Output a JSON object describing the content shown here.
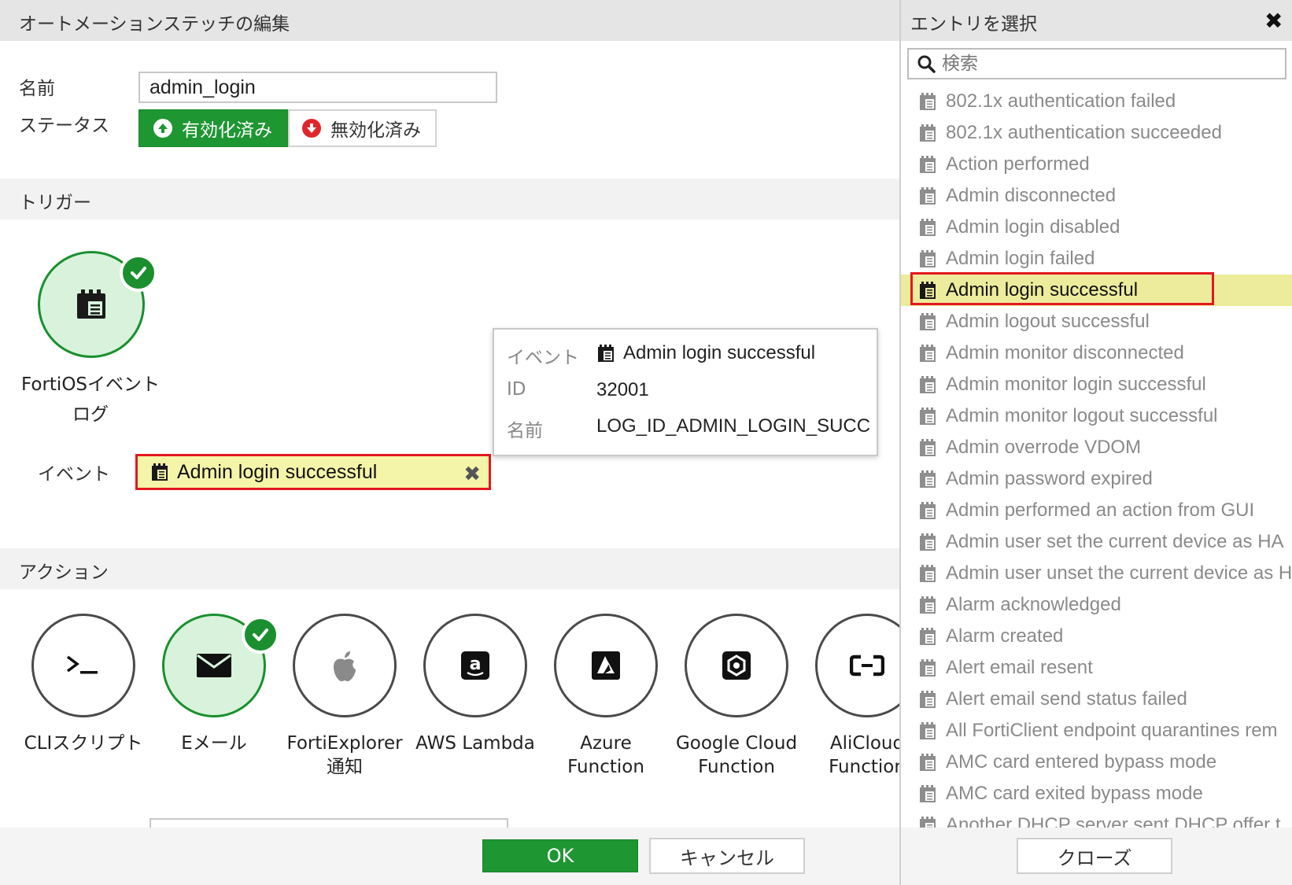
{
  "dialog": {
    "title": "オートメーションステッチの編集",
    "name_label": "名前",
    "name_value": "admin_login",
    "status_label": "ステータス",
    "status_enabled": "有効化済み",
    "status_disabled": "無効化済み",
    "trigger_section": "トリガー",
    "trigger_name": "FortiOSイベントログ",
    "event_label": "イベント",
    "event_value": "Admin login successful",
    "action_section": "アクション",
    "ok": "OK",
    "cancel": "キャンセル"
  },
  "tooltip": {
    "event_key": "イベント",
    "event_value": "Admin login successful",
    "id_key": "ID",
    "id_value": "32001",
    "name_key": "名前",
    "name_value": "LOG_ID_ADMIN_LOGIN_SUCC"
  },
  "actions": [
    {
      "label_line1": "CLIスクリプト",
      "label_line2": "",
      "icon": "terminal-icon",
      "selected": false
    },
    {
      "label_line1": "Eメール",
      "label_line2": "",
      "icon": "envelope-icon",
      "selected": true
    },
    {
      "label_line1": "FortiExplorer",
      "label_line2": "通知",
      "icon": "apple-icon",
      "selected": false
    },
    {
      "label_line1": "AWS Lambda",
      "label_line2": "",
      "icon": "amazon-icon",
      "selected": false
    },
    {
      "label_line1": "Azure",
      "label_line2": "Function",
      "icon": "azure-icon",
      "selected": false
    },
    {
      "label_line1": "Google Cloud",
      "label_line2": "Function",
      "icon": "google-cloud-icon",
      "selected": false
    },
    {
      "label_line1": "AliCloud",
      "label_line2": "Function",
      "icon": "alicloud-icon",
      "selected": false
    }
  ],
  "entry_panel": {
    "title": "エントリを選択",
    "search_placeholder": "検索",
    "close_button": "クローズ",
    "selected_index": 6,
    "entries": [
      "802.1x authentication failed",
      "802.1x authentication succeeded",
      "Action performed",
      "Admin disconnected",
      "Admin login disabled",
      "Admin login failed",
      "Admin login successful",
      "Admin logout successful",
      "Admin monitor disconnected",
      "Admin monitor login successful",
      "Admin monitor logout successful",
      "Admin overrode VDOM",
      "Admin password expired",
      "Admin performed an action from GUI",
      "Admin user set the current device as HA",
      "Admin user unset the current device as H",
      "Alarm acknowledged",
      "Alarm created",
      "Alert email resent",
      "Alert email send status failed",
      "All FortiClient endpoint quarantines rem",
      "AMC card entered bypass mode",
      "AMC card exited bypass mode",
      "Another DHCP server sent DHCP offer t"
    ]
  },
  "colors": {
    "accent_green": "#1e9632",
    "highlight_yellow": "#f5f5a9",
    "selection_red": "#e4171f"
  }
}
